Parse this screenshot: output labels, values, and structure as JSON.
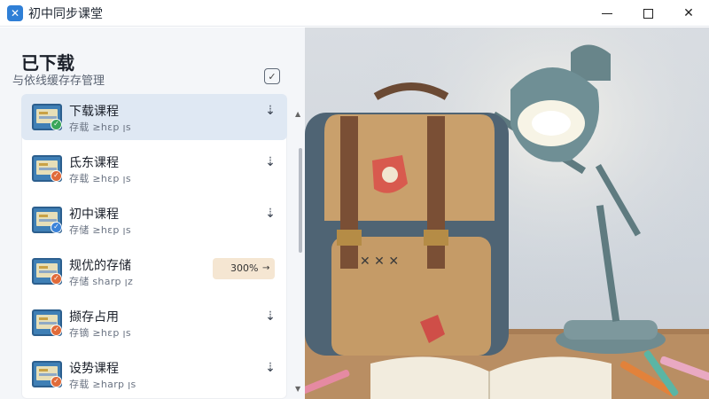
{
  "window": {
    "app_icon": "app-logo-icon",
    "title": "初中同步课堂",
    "minimize_icon": "minimize-icon",
    "maximize_icon": "maximize-icon",
    "close_icon": "close-icon"
  },
  "page": {
    "title": "已下载",
    "subtitle": "与依线缓存存管理",
    "select_icon": "checkbox-icon"
  },
  "items": [
    {
      "name": "下载课程",
      "meta": "存载 ≥hεp ꞁs",
      "status": "green",
      "action": "download-icon"
    },
    {
      "name": "氐东课程",
      "meta": "存载 ≥hεp ꞁs",
      "status": "orange",
      "action": "download-icon"
    },
    {
      "name": "初中课程",
      "meta": "存储 ≥hεp ꞁs",
      "status": "blue",
      "action": "download-icon"
    },
    {
      "name": "规优的存储",
      "meta": "存储 sharp ꞁz",
      "status": "orange",
      "progress": "300%"
    },
    {
      "name": "撷存占用",
      "meta": "存镝 ≥hεp ꞁs",
      "status": "orange",
      "action": "download-icon"
    },
    {
      "name": "设势课程",
      "meta": "存载 ≥harp ꞁs",
      "status": "orange",
      "action": "download-icon"
    }
  ],
  "colors": {
    "accent": "#2f7fd6",
    "active_row": "#dfe8f3",
    "progress_bg": "#f5e6d2",
    "status_green": "#3aa65a",
    "status_orange": "#e06b3a",
    "status_blue": "#3b83d9"
  }
}
